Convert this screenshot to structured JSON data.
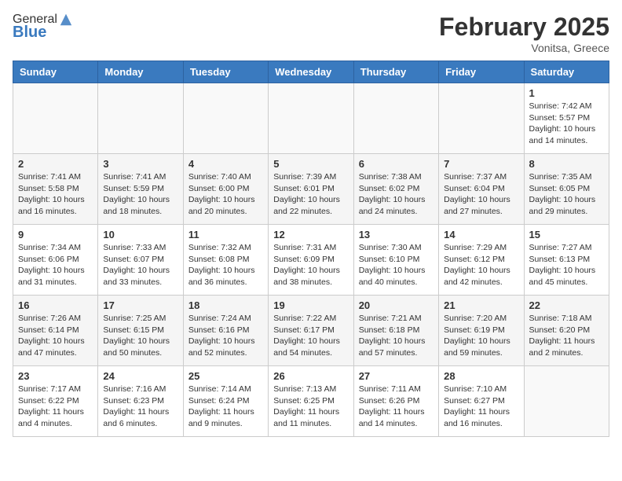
{
  "header": {
    "logo_general": "General",
    "logo_blue": "Blue",
    "month_title": "February 2025",
    "subtitle": "Vonitsa, Greece"
  },
  "days_of_week": [
    "Sunday",
    "Monday",
    "Tuesday",
    "Wednesday",
    "Thursday",
    "Friday",
    "Saturday"
  ],
  "weeks": [
    {
      "shade": "white",
      "days": [
        {
          "num": "",
          "info": ""
        },
        {
          "num": "",
          "info": ""
        },
        {
          "num": "",
          "info": ""
        },
        {
          "num": "",
          "info": ""
        },
        {
          "num": "",
          "info": ""
        },
        {
          "num": "",
          "info": ""
        },
        {
          "num": "1",
          "info": "Sunrise: 7:42 AM\nSunset: 5:57 PM\nDaylight: 10 hours and 14 minutes."
        }
      ]
    },
    {
      "shade": "shade",
      "days": [
        {
          "num": "2",
          "info": "Sunrise: 7:41 AM\nSunset: 5:58 PM\nDaylight: 10 hours and 16 minutes."
        },
        {
          "num": "3",
          "info": "Sunrise: 7:41 AM\nSunset: 5:59 PM\nDaylight: 10 hours and 18 minutes."
        },
        {
          "num": "4",
          "info": "Sunrise: 7:40 AM\nSunset: 6:00 PM\nDaylight: 10 hours and 20 minutes."
        },
        {
          "num": "5",
          "info": "Sunrise: 7:39 AM\nSunset: 6:01 PM\nDaylight: 10 hours and 22 minutes."
        },
        {
          "num": "6",
          "info": "Sunrise: 7:38 AM\nSunset: 6:02 PM\nDaylight: 10 hours and 24 minutes."
        },
        {
          "num": "7",
          "info": "Sunrise: 7:37 AM\nSunset: 6:04 PM\nDaylight: 10 hours and 27 minutes."
        },
        {
          "num": "8",
          "info": "Sunrise: 7:35 AM\nSunset: 6:05 PM\nDaylight: 10 hours and 29 minutes."
        }
      ]
    },
    {
      "shade": "white",
      "days": [
        {
          "num": "9",
          "info": "Sunrise: 7:34 AM\nSunset: 6:06 PM\nDaylight: 10 hours and 31 minutes."
        },
        {
          "num": "10",
          "info": "Sunrise: 7:33 AM\nSunset: 6:07 PM\nDaylight: 10 hours and 33 minutes."
        },
        {
          "num": "11",
          "info": "Sunrise: 7:32 AM\nSunset: 6:08 PM\nDaylight: 10 hours and 36 minutes."
        },
        {
          "num": "12",
          "info": "Sunrise: 7:31 AM\nSunset: 6:09 PM\nDaylight: 10 hours and 38 minutes."
        },
        {
          "num": "13",
          "info": "Sunrise: 7:30 AM\nSunset: 6:10 PM\nDaylight: 10 hours and 40 minutes."
        },
        {
          "num": "14",
          "info": "Sunrise: 7:29 AM\nSunset: 6:12 PM\nDaylight: 10 hours and 42 minutes."
        },
        {
          "num": "15",
          "info": "Sunrise: 7:27 AM\nSunset: 6:13 PM\nDaylight: 10 hours and 45 minutes."
        }
      ]
    },
    {
      "shade": "shade",
      "days": [
        {
          "num": "16",
          "info": "Sunrise: 7:26 AM\nSunset: 6:14 PM\nDaylight: 10 hours and 47 minutes."
        },
        {
          "num": "17",
          "info": "Sunrise: 7:25 AM\nSunset: 6:15 PM\nDaylight: 10 hours and 50 minutes."
        },
        {
          "num": "18",
          "info": "Sunrise: 7:24 AM\nSunset: 6:16 PM\nDaylight: 10 hours and 52 minutes."
        },
        {
          "num": "19",
          "info": "Sunrise: 7:22 AM\nSunset: 6:17 PM\nDaylight: 10 hours and 54 minutes."
        },
        {
          "num": "20",
          "info": "Sunrise: 7:21 AM\nSunset: 6:18 PM\nDaylight: 10 hours and 57 minutes."
        },
        {
          "num": "21",
          "info": "Sunrise: 7:20 AM\nSunset: 6:19 PM\nDaylight: 10 hours and 59 minutes."
        },
        {
          "num": "22",
          "info": "Sunrise: 7:18 AM\nSunset: 6:20 PM\nDaylight: 11 hours and 2 minutes."
        }
      ]
    },
    {
      "shade": "white",
      "days": [
        {
          "num": "23",
          "info": "Sunrise: 7:17 AM\nSunset: 6:22 PM\nDaylight: 11 hours and 4 minutes."
        },
        {
          "num": "24",
          "info": "Sunrise: 7:16 AM\nSunset: 6:23 PM\nDaylight: 11 hours and 6 minutes."
        },
        {
          "num": "25",
          "info": "Sunrise: 7:14 AM\nSunset: 6:24 PM\nDaylight: 11 hours and 9 minutes."
        },
        {
          "num": "26",
          "info": "Sunrise: 7:13 AM\nSunset: 6:25 PM\nDaylight: 11 hours and 11 minutes."
        },
        {
          "num": "27",
          "info": "Sunrise: 7:11 AM\nSunset: 6:26 PM\nDaylight: 11 hours and 14 minutes."
        },
        {
          "num": "28",
          "info": "Sunrise: 7:10 AM\nSunset: 6:27 PM\nDaylight: 11 hours and 16 minutes."
        },
        {
          "num": "",
          "info": ""
        }
      ]
    }
  ]
}
